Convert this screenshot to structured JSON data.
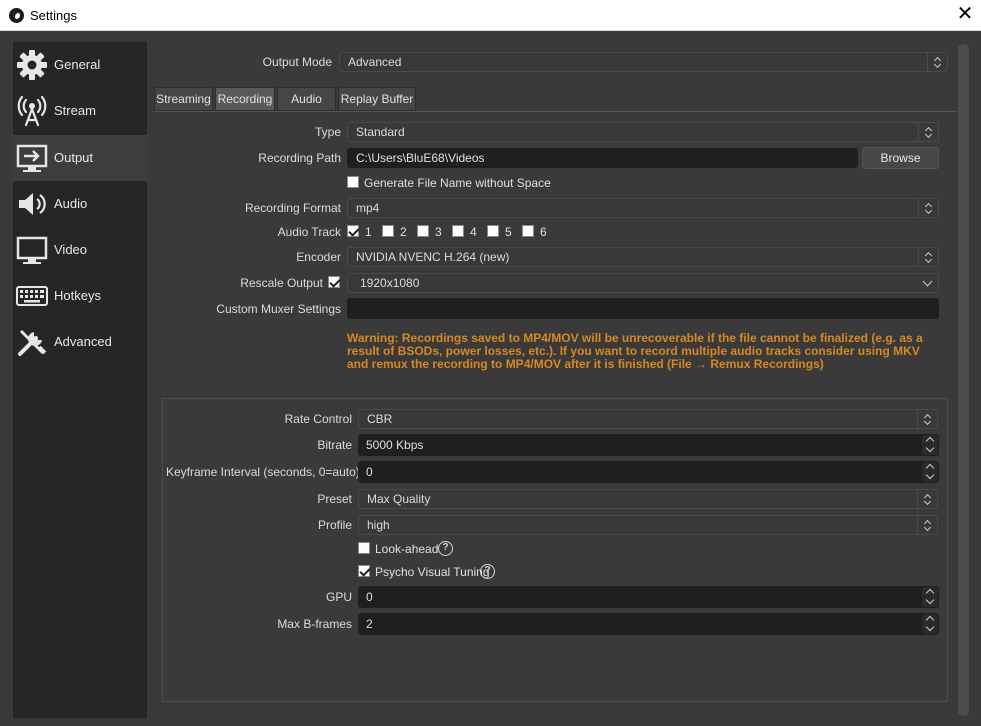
{
  "window": {
    "title": "Settings",
    "close_glyph": "✕"
  },
  "sidebar": {
    "items": [
      {
        "label": "General",
        "icon": "gear-icon"
      },
      {
        "label": "Stream",
        "icon": "antenna-icon"
      },
      {
        "label": "Output",
        "icon": "output-monitor-icon",
        "active": true
      },
      {
        "label": "Audio",
        "icon": "speaker-icon"
      },
      {
        "label": "Video",
        "icon": "monitor-icon"
      },
      {
        "label": "Hotkeys",
        "icon": "keyboard-icon"
      },
      {
        "label": "Advanced",
        "icon": "tools-icon"
      }
    ]
  },
  "output_mode": {
    "label": "Output Mode",
    "value": "Advanced"
  },
  "tabs": [
    {
      "label": "Streaming"
    },
    {
      "label": "Recording",
      "active": true
    },
    {
      "label": "Audio"
    },
    {
      "label": "Replay Buffer"
    }
  ],
  "recording": {
    "type": {
      "label": "Type",
      "value": "Standard"
    },
    "path": {
      "label": "Recording Path",
      "value": "C:\\Users\\BluE68\\Videos",
      "browse": "Browse"
    },
    "no_space": {
      "label": "Generate File Name without Space",
      "checked": false
    },
    "format": {
      "label": "Recording Format",
      "value": "mp4"
    },
    "audio_track": {
      "label": "Audio Track",
      "tracks": [
        {
          "label": "1",
          "checked": true
        },
        {
          "label": "2",
          "checked": false
        },
        {
          "label": "3",
          "checked": false
        },
        {
          "label": "4",
          "checked": false
        },
        {
          "label": "5",
          "checked": false
        },
        {
          "label": "6",
          "checked": false
        }
      ]
    },
    "encoder": {
      "label": "Encoder",
      "value": "NVIDIA NVENC H.264 (new)"
    },
    "rescale": {
      "label": "Rescale Output",
      "checked": true,
      "value": "1920x1080"
    },
    "muxer": {
      "label": "Custom Muxer Settings",
      "value": ""
    },
    "warning": "Warning: Recordings saved to MP4/MOV will be unrecoverable if the file cannot be finalized (e.g. as a result of BSODs, power losses, etc.). If you want to record multiple audio tracks consider using MKV and remux the recording to MP4/MOV after it is finished (File → Remux Recordings)"
  },
  "encoder_settings": {
    "rate_control": {
      "label": "Rate Control",
      "value": "CBR"
    },
    "bitrate": {
      "label": "Bitrate",
      "value": "5000 Kbps"
    },
    "keyframe": {
      "label": "Keyframe Interval (seconds, 0=auto)",
      "value": "0"
    },
    "preset": {
      "label": "Preset",
      "value": "Max Quality"
    },
    "profile": {
      "label": "Profile",
      "value": "high"
    },
    "lookahead": {
      "label": "Look-ahead",
      "checked": false,
      "help": "?"
    },
    "psycho": {
      "label": "Psycho Visual Tuning",
      "checked": true,
      "help": "?"
    },
    "gpu": {
      "label": "GPU",
      "value": "0"
    },
    "bframes": {
      "label": "Max B-frames",
      "value": "2"
    }
  },
  "colors": {
    "warning": "#d8891e",
    "sidebar_bg": "#262626",
    "panel_bg": "#3a3a3a"
  }
}
